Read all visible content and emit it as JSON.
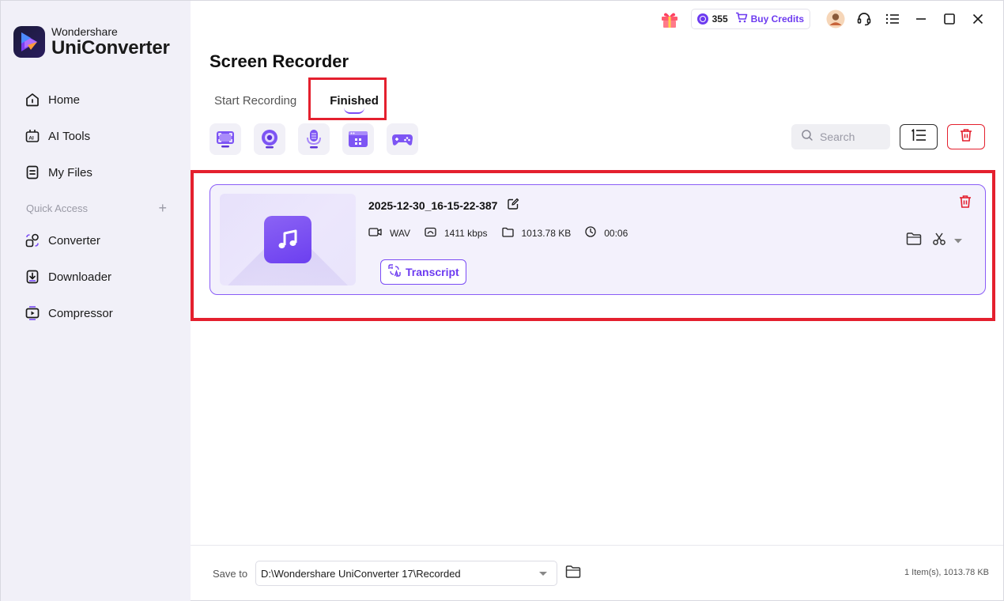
{
  "app": {
    "brand": "Wondershare",
    "product": "UniConverter"
  },
  "sidebar": {
    "items": [
      {
        "label": "Home",
        "icon": "home-icon"
      },
      {
        "label": "AI Tools",
        "icon": "ai-tools-icon"
      },
      {
        "label": "My Files",
        "icon": "my-files-icon"
      }
    ],
    "quick_access_label": "Quick Access",
    "quick_access_add": "+",
    "quick_items": [
      {
        "label": "Converter",
        "icon": "converter-icon"
      },
      {
        "label": "Downloader",
        "icon": "downloader-icon"
      },
      {
        "label": "Compressor",
        "icon": "compressor-icon"
      }
    ]
  },
  "topbar": {
    "credits": "355",
    "buy_credits": "Buy Credits"
  },
  "page": {
    "title": "Screen Recorder",
    "tabs": [
      {
        "label": "Start Recording",
        "active": false
      },
      {
        "label": "Finished",
        "active": true
      }
    ],
    "search_placeholder": "Search"
  },
  "recordings": [
    {
      "name": "2025-12-30_16-15-22-387",
      "format": "WAV",
      "bitrate": "1411 kbps",
      "size": "1013.78 KB",
      "duration": "00:06",
      "transcript_label": "Transcript"
    }
  ],
  "footer": {
    "save_to_label": "Save to",
    "path": "D:\\Wondershare UniConverter 17\\Recorded",
    "status": "1 Item(s), 1013.78 KB"
  },
  "colors": {
    "accent": "#6d3bf0",
    "highlight": "#e4202e",
    "sidebar_bg": "#f1f0f8"
  }
}
